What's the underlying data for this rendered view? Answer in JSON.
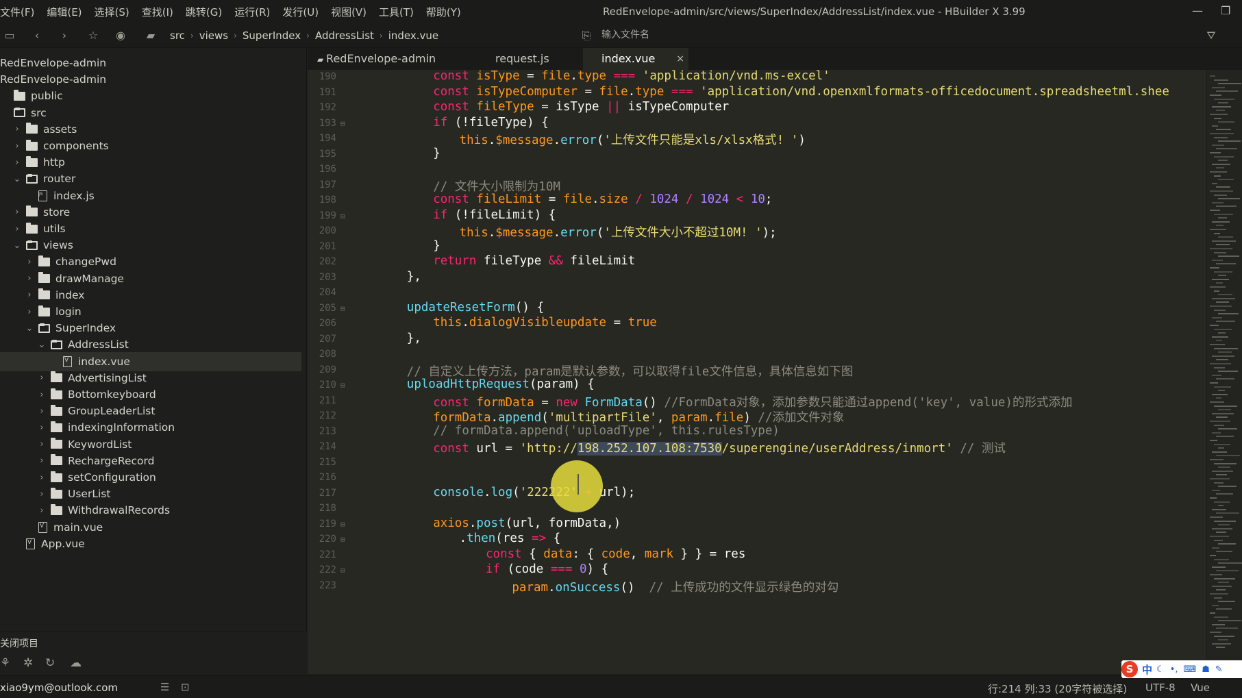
{
  "menu": [
    "文件(F)",
    "编辑(E)",
    "选择(S)",
    "查找(I)",
    "跳转(G)",
    "运行(R)",
    "发行(U)",
    "视图(V)",
    "工具(T)",
    "帮助(Y)"
  ],
  "window_title": "RedEnvelope-admin/src/views/SuperIndex/AddressList/index.vue - HBuilder X 3.99",
  "breadcrumb": [
    "src",
    "views",
    "SuperIndex",
    "AddressList",
    "index.vue"
  ],
  "file_search_placeholder": "输入文件名",
  "tree": [
    {
      "label": "RedEnvelope-admin",
      "depth": 0,
      "kind": "root"
    },
    {
      "label": "RedEnvelope-admin",
      "depth": 0,
      "kind": "root"
    },
    {
      "label": "public",
      "depth": 0,
      "kind": "folder",
      "open": false,
      "chev": false
    },
    {
      "label": "src",
      "depth": 0,
      "kind": "folder",
      "open": true,
      "chev": false
    },
    {
      "label": "assets",
      "depth": 1,
      "kind": "folder",
      "open": false
    },
    {
      "label": "components",
      "depth": 1,
      "kind": "folder",
      "open": false
    },
    {
      "label": "http",
      "depth": 1,
      "kind": "folder",
      "open": false
    },
    {
      "label": "router",
      "depth": 1,
      "kind": "folder",
      "open": true
    },
    {
      "label": "index.js",
      "depth": 2,
      "kind": "file",
      "ext": "j"
    },
    {
      "label": "store",
      "depth": 1,
      "kind": "folder",
      "open": false
    },
    {
      "label": "utils",
      "depth": 1,
      "kind": "folder",
      "open": false
    },
    {
      "label": "views",
      "depth": 1,
      "kind": "folder",
      "open": true
    },
    {
      "label": "changePwd",
      "depth": 2,
      "kind": "folder",
      "open": false
    },
    {
      "label": "drawManage",
      "depth": 2,
      "kind": "folder",
      "open": false
    },
    {
      "label": "index",
      "depth": 2,
      "kind": "folder",
      "open": false
    },
    {
      "label": "login",
      "depth": 2,
      "kind": "folder",
      "open": false
    },
    {
      "label": "SuperIndex",
      "depth": 2,
      "kind": "folder",
      "open": true
    },
    {
      "label": "AddressList",
      "depth": 3,
      "kind": "folder",
      "open": true
    },
    {
      "label": "index.vue",
      "depth": 4,
      "kind": "file",
      "ext": "v",
      "selected": true
    },
    {
      "label": "AdvertisingList",
      "depth": 3,
      "kind": "folder",
      "open": false
    },
    {
      "label": "Bottomkeyboard",
      "depth": 3,
      "kind": "folder",
      "open": false
    },
    {
      "label": "GroupLeaderList",
      "depth": 3,
      "kind": "folder",
      "open": false
    },
    {
      "label": "indexingInformation",
      "depth": 3,
      "kind": "folder",
      "open": false
    },
    {
      "label": "KeywordList",
      "depth": 3,
      "kind": "folder",
      "open": false
    },
    {
      "label": "RechargeRecord",
      "depth": 3,
      "kind": "folder",
      "open": false
    },
    {
      "label": "setConfiguration",
      "depth": 3,
      "kind": "folder",
      "open": false
    },
    {
      "label": "UserList",
      "depth": 3,
      "kind": "folder",
      "open": false
    },
    {
      "label": "WithdrawalRecords",
      "depth": 3,
      "kind": "folder",
      "open": false
    },
    {
      "label": "main.vue",
      "depth": 2,
      "kind": "file",
      "ext": "v"
    },
    {
      "label": "App.vue",
      "depth": 1,
      "kind": "file",
      "ext": "v"
    }
  ],
  "close_project": "关闭项目",
  "tabs": [
    {
      "label": "RedEnvelope-admin",
      "icon": "folder-icon",
      "active": false
    },
    {
      "label": "request.js",
      "active": false
    },
    {
      "label": "index.vue",
      "active": true,
      "close": "×"
    }
  ],
  "code": [
    {
      "n": "190",
      "fold": false,
      "indent": 3,
      "tokens": [
        [
          "kw",
          "const "
        ],
        [
          "vr",
          "isType"
        ],
        [
          "plain",
          " = "
        ],
        [
          "vr",
          "file"
        ],
        [
          "plain",
          "."
        ],
        [
          "vr",
          "type"
        ],
        [
          "kw",
          " === "
        ],
        [
          "str",
          "'application/vnd.ms-excel'"
        ]
      ]
    },
    {
      "n": "191",
      "fold": false,
      "indent": 3,
      "tokens": [
        [
          "kw",
          "const "
        ],
        [
          "vr",
          "isTypeComputer"
        ],
        [
          "plain",
          " = "
        ],
        [
          "vr",
          "file"
        ],
        [
          "plain",
          "."
        ],
        [
          "vr",
          "type"
        ],
        [
          "kw",
          " === "
        ],
        [
          "str",
          "'application/vnd.openxmlformats-officedocument.spreadsheetml.shee"
        ]
      ]
    },
    {
      "n": "192",
      "fold": false,
      "indent": 3,
      "tokens": [
        [
          "kw",
          "const "
        ],
        [
          "vr",
          "fileType"
        ],
        [
          "plain",
          " = isType "
        ],
        [
          "kw",
          "||"
        ],
        [
          "plain",
          " isTypeComputer"
        ]
      ]
    },
    {
      "n": "193",
      "fold": true,
      "indent": 3,
      "tokens": [
        [
          "kw",
          "if"
        ],
        [
          "plain",
          " (!fileType) {"
        ]
      ]
    },
    {
      "n": "194",
      "fold": false,
      "indent": 4,
      "tokens": [
        [
          "vr",
          "this"
        ],
        [
          "plain",
          "."
        ],
        [
          "vr",
          "$message"
        ],
        [
          "plain",
          "."
        ],
        [
          "fn",
          "error"
        ],
        [
          "plain",
          "("
        ],
        [
          "str",
          "'上传文件只能是xls/xlsx格式! '"
        ],
        [
          "plain",
          ")"
        ]
      ]
    },
    {
      "n": "195",
      "fold": false,
      "indent": 3,
      "tokens": [
        [
          "plain",
          "}"
        ]
      ]
    },
    {
      "n": "196",
      "fold": false,
      "indent": 0,
      "tokens": []
    },
    {
      "n": "197",
      "fold": false,
      "indent": 3,
      "tokens": [
        [
          "cm",
          "// 文件大小限制为10M"
        ]
      ]
    },
    {
      "n": "198",
      "fold": false,
      "indent": 3,
      "tokens": [
        [
          "kw",
          "const "
        ],
        [
          "vr",
          "fileLimit"
        ],
        [
          "plain",
          " = "
        ],
        [
          "vr",
          "file"
        ],
        [
          "plain",
          "."
        ],
        [
          "vr",
          "size"
        ],
        [
          "kw",
          " / "
        ],
        [
          "num",
          "1024"
        ],
        [
          "kw",
          " / "
        ],
        [
          "num",
          "1024"
        ],
        [
          "kw",
          " < "
        ],
        [
          "num",
          "10"
        ],
        [
          "plain",
          ";"
        ]
      ]
    },
    {
      "n": "199",
      "fold": true,
      "indent": 3,
      "tokens": [
        [
          "kw",
          "if"
        ],
        [
          "plain",
          " (!fileLimit) {"
        ]
      ]
    },
    {
      "n": "200",
      "fold": false,
      "indent": 4,
      "tokens": [
        [
          "vr",
          "this"
        ],
        [
          "plain",
          "."
        ],
        [
          "vr",
          "$message"
        ],
        [
          "plain",
          "."
        ],
        [
          "fn",
          "error"
        ],
        [
          "plain",
          "("
        ],
        [
          "str",
          "'上传文件大小不超过10M! '"
        ],
        [
          "plain",
          ");"
        ]
      ]
    },
    {
      "n": "201",
      "fold": false,
      "indent": 3,
      "tokens": [
        [
          "plain",
          "}"
        ]
      ]
    },
    {
      "n": "202",
      "fold": false,
      "indent": 3,
      "tokens": [
        [
          "kw",
          "return "
        ],
        [
          "plain",
          "fileType "
        ],
        [
          "kw",
          "&&"
        ],
        [
          "plain",
          " fileLimit"
        ]
      ]
    },
    {
      "n": "203",
      "fold": false,
      "indent": 2,
      "tokens": [
        [
          "plain",
          "},"
        ]
      ]
    },
    {
      "n": "204",
      "fold": false,
      "indent": 0,
      "tokens": []
    },
    {
      "n": "205",
      "fold": true,
      "indent": 2,
      "tokens": [
        [
          "fn",
          "updateResetForm"
        ],
        [
          "plain",
          "() {"
        ]
      ]
    },
    {
      "n": "206",
      "fold": false,
      "indent": 3,
      "tokens": [
        [
          "vr",
          "this"
        ],
        [
          "plain",
          "."
        ],
        [
          "vr",
          "dialogVisibleupdate"
        ],
        [
          "plain",
          " = "
        ],
        [
          "vr",
          "true"
        ]
      ]
    },
    {
      "n": "207",
      "fold": false,
      "indent": 2,
      "tokens": [
        [
          "plain",
          "},"
        ]
      ]
    },
    {
      "n": "208",
      "fold": false,
      "indent": 0,
      "tokens": []
    },
    {
      "n": "209",
      "fold": false,
      "indent": 2,
      "tokens": [
        [
          "cm",
          "// 自定义上传方法，param是默认参数，可以取得file文件信息，具体信息如下图"
        ]
      ]
    },
    {
      "n": "210",
      "fold": true,
      "indent": 2,
      "tokens": [
        [
          "fn",
          "uploadHttpRequest"
        ],
        [
          "plain",
          "(param) {"
        ]
      ]
    },
    {
      "n": "211",
      "fold": false,
      "indent": 3,
      "tokens": [
        [
          "kw",
          "const "
        ],
        [
          "vr",
          "formData"
        ],
        [
          "plain",
          " = "
        ],
        [
          "kw",
          "new "
        ],
        [
          "fn",
          "FormData"
        ],
        [
          "plain",
          "() "
        ],
        [
          "cm",
          "//FormData对象，添加参数只能通过append('key', value)的形式添加"
        ]
      ]
    },
    {
      "n": "212",
      "fold": false,
      "indent": 3,
      "tokens": [
        [
          "vr",
          "formData"
        ],
        [
          "plain",
          "."
        ],
        [
          "fn",
          "append"
        ],
        [
          "plain",
          "("
        ],
        [
          "str",
          "'multipartFile'"
        ],
        [
          "plain",
          ", "
        ],
        [
          "vr",
          "param"
        ],
        [
          "plain",
          "."
        ],
        [
          "vr",
          "file"
        ],
        [
          "plain",
          ") "
        ],
        [
          "cm",
          "//添加文件对象"
        ]
      ]
    },
    {
      "n": "213",
      "fold": false,
      "indent": 3,
      "tokens": [
        [
          "cm",
          "// formData.append('uploadType', this.rulesType)"
        ]
      ]
    },
    {
      "n": "214",
      "fold": false,
      "indent": 3,
      "tokens": [
        [
          "kw",
          "const "
        ],
        [
          "plain",
          "url = "
        ],
        [
          "str",
          "'http://"
        ],
        [
          "str sel",
          "198.252.107.108:7530"
        ],
        [
          "str",
          "/superengine/userAddress/inmort'"
        ],
        [
          "cm",
          " // 测试"
        ]
      ]
    },
    {
      "n": "215",
      "fold": false,
      "indent": 0,
      "tokens": []
    },
    {
      "n": "216",
      "fold": false,
      "indent": 0,
      "tokens": []
    },
    {
      "n": "217",
      "fold": false,
      "indent": 3,
      "tokens": [
        [
          "fn",
          "console"
        ],
        [
          "plain",
          "."
        ],
        [
          "fn",
          "log"
        ],
        [
          "plain",
          "("
        ],
        [
          "str",
          "'222222'"
        ],
        [
          "kw",
          " + "
        ],
        [
          "plain",
          "url);"
        ]
      ]
    },
    {
      "n": "218",
      "fold": false,
      "indent": 0,
      "tokens": []
    },
    {
      "n": "219",
      "fold": true,
      "indent": 3,
      "tokens": [
        [
          "vr",
          "axios"
        ],
        [
          "plain",
          "."
        ],
        [
          "fn",
          "post"
        ],
        [
          "plain",
          "(url, formData,)"
        ]
      ]
    },
    {
      "n": "220",
      "fold": true,
      "indent": 4,
      "tokens": [
        [
          "plain",
          "."
        ],
        [
          "fn",
          "then"
        ],
        [
          "plain",
          "(res "
        ],
        [
          "kw",
          "=>"
        ],
        [
          "plain",
          " {"
        ]
      ]
    },
    {
      "n": "221",
      "fold": false,
      "indent": 5,
      "tokens": [
        [
          "kw",
          "const "
        ],
        [
          "plain",
          "{ "
        ],
        [
          "vr",
          "data"
        ],
        [
          "plain",
          ": { "
        ],
        [
          "vr",
          "code"
        ],
        [
          "plain",
          ", "
        ],
        [
          "vr",
          "mark"
        ],
        [
          "plain",
          " } } = res"
        ]
      ]
    },
    {
      "n": "222",
      "fold": true,
      "indent": 5,
      "tokens": [
        [
          "kw",
          "if"
        ],
        [
          "plain",
          " (code "
        ],
        [
          "kw",
          "==="
        ],
        [
          "plain",
          " "
        ],
        [
          "num",
          "0"
        ],
        [
          "plain",
          ") {"
        ]
      ]
    },
    {
      "n": "223",
      "fold": false,
      "indent": 6,
      "tokens": [
        [
          "vr",
          "param"
        ],
        [
          "plain",
          "."
        ],
        [
          "fn",
          "onSuccess"
        ],
        [
          "plain",
          "()  "
        ],
        [
          "cm",
          "// 上传成功的文件显示绿色的对勾"
        ]
      ]
    }
  ],
  "status": {
    "account": "xiao9ym@outlook.com",
    "position": "行:214  列:33 (20字符被选择)",
    "encoding": "UTF-8",
    "language": "Vue"
  },
  "ime": {
    "logo": "S",
    "mode": "中"
  },
  "colors": {
    "editor_bg": "#272822",
    "sidebar_bg": "#1e1f1c",
    "keyword": "#f92672",
    "string": "#e6db74",
    "number": "#ae81ff",
    "function": "#66d9ef",
    "variable": "#fd971f",
    "comment": "#8b8a80",
    "cursor_highlight": "#e6dc3c"
  }
}
